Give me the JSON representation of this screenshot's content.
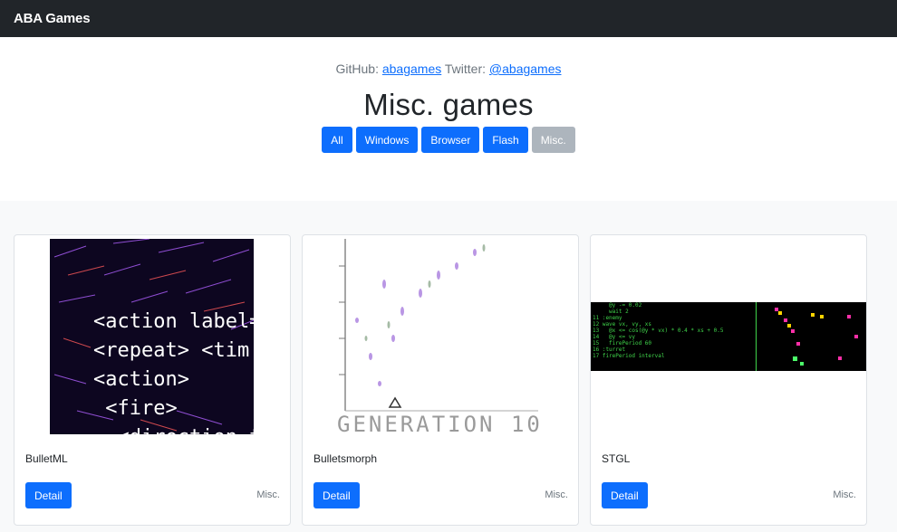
{
  "navbar": {
    "brand": "ABA Games"
  },
  "hero": {
    "github_label": "GitHub:",
    "github_link": "abagames",
    "twitter_label": "Twitter:",
    "twitter_link": "@abagames",
    "title": "Misc. games"
  },
  "filters": [
    {
      "label": "All",
      "active": false
    },
    {
      "label": "Windows",
      "active": false
    },
    {
      "label": "Browser",
      "active": false
    },
    {
      "label": "Flash",
      "active": false
    },
    {
      "label": "Misc.",
      "active": true
    }
  ],
  "cards": [
    {
      "name": "BulletML",
      "button": "Detail",
      "category": "Misc.",
      "thumb_text": "<action label=\n<repeat> <tim\n<action>\n <fire>\n  <direction t"
    },
    {
      "name": "Bulletsmorph",
      "button": "Detail",
      "category": "Misc.",
      "thumb_text": "GENERATION 10"
    },
    {
      "name": "STGL",
      "button": "Detail",
      "category": "Misc.",
      "thumb_text": "     @y -= 0.02\n     wait 2\n11 :enemy\n12 wave vx, vy, xs\n13   @x <= cos(@y * vx) * 0.4 * xs + 0.5\n14   @y <= vy\n15   firePeriod 60\n16 :turret\n17 firePeriod interval"
    }
  ]
}
